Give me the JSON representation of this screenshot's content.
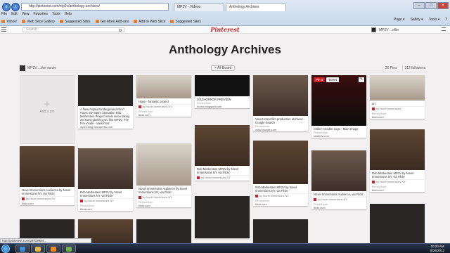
{
  "browser": {
    "address": "http://pinterest.com/mp2v/anthology-archives/",
    "tabs": [
      {
        "label": "MP2V - Videos",
        "active": false
      },
      {
        "label": "Anthology Archives",
        "active": true
      }
    ],
    "menu": [
      "File",
      "Edit",
      "View",
      "Favorites",
      "Tools",
      "Help"
    ],
    "favorites": [
      "Yahoo!",
      "Web Slice Gallery",
      "Suggested Sites",
      "Get More Add-ons",
      "Add to Web Slice",
      "Suggested Sites"
    ],
    "tools": [
      "Page ▾",
      "Safety ▾",
      "Tools ▾",
      "?"
    ]
  },
  "topbar": {
    "search_placeholder": "Search",
    "logo": "Pinterest",
    "user_name": "MP2V ...ollie"
  },
  "board": {
    "title": "Anthology Archives",
    "owner": "MP2V ...the movie",
    "follow_label": "+ All Board",
    "pins_count": "26 Pins",
    "followers_count": "312 followers"
  },
  "add_pin_label": "Add a pin",
  "cards": [
    {
      "caption": "A New Angled Underground Film? Hope: the Mp2V animation Rob Merkestein Project movie since taking we knew glowing you film MP2V: The Fire inside - View Post",
      "source_label": "Pinned from",
      "source": "mp2v.blog.wordpress.com"
    },
    {
      "caption": "Hope - fantastic project",
      "source_label": "Pinned from",
      "source": "flickr.com",
      "via": "by Novel Immersions NY"
    },
    {
      "caption": "2012HORROR PREVIEW",
      "source_label": "Pinned from",
      "source": "horror.blogspot.com"
    },
    {
      "caption": "View Horror film production archived - Google Search",
      "source_label": "Pinned from",
      "source": "www.google.com"
    },
    {
      "caption": "Chiller: Double Logo - Main Image",
      "source_label": "Pinned from",
      "source": "chillertv.com"
    },
    {
      "caption": "art",
      "source_label": "Pinned from",
      "source": "flickr.com",
      "via": "by Novel Immersions"
    },
    {
      "caption": "Rob Merkestein MP2V by Novel Immersions NY, via Flickr",
      "source_label": "Pinned from",
      "source": "flickr.com",
      "via": "by Novel Immersions NY"
    },
    {
      "caption": "Rob Merkestein MP2V by Novel Immersions NY, via Flickr",
      "source_label": "Pinned from",
      "source": "flickr.com",
      "via": "by Novel Immersions NY"
    },
    {
      "caption": "Rob Merkestein MP2V by Novel Immersions NY, via Flickr",
      "source_label": "Pinned from",
      "source": "flickr.com",
      "via": "by Novel Immersions NY"
    },
    {
      "caption": "Rob Merkestein MP2V by Novel Immersions NY, via Flickr",
      "source_label": "Pinned from",
      "source": "flickr.com",
      "via": "by Novel Immersions NY"
    },
    {
      "caption": "Novel Immersions Audience by Novel Immersions NY, via Flickr",
      "source_label": "Pinned from",
      "source": "flickr.com",
      "via": "by Novel Immersions NY"
    },
    {
      "caption": "Novel Immersions Audience, via Flickr",
      "source_label": "Pinned from",
      "source": "flickr.com",
      "via": "by Novel Immersions NY"
    },
    {
      "caption": "Novel Immersions Audience by Novel Immersions NY, via Flickr",
      "source_label": "Pinned from",
      "source": "flickr.com",
      "via": "by Novel Immersions NY"
    }
  ],
  "pin_buttons": {
    "pin": "Pin it",
    "tweet": "Tweet",
    "edit": "✎"
  },
  "status_bar": "http://pinterest.com/pin/19984...",
  "clock": {
    "time": "10:20 AM",
    "date": "8/24/2012"
  },
  "colors": {
    "pinterest_red": "#cb2027",
    "page_bg": "#f2f0f0"
  }
}
